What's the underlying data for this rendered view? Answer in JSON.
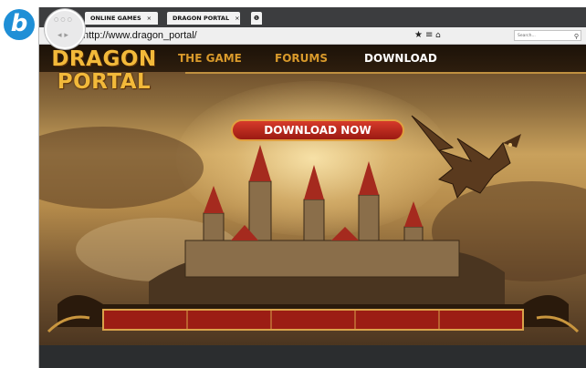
{
  "figure_label": "b",
  "browser": {
    "tabs": [
      {
        "label": "ONLINE GAMES",
        "close": "×"
      },
      {
        "label": "DRAGON PORTAL",
        "close": "×"
      }
    ],
    "new_tab_icon": "info-icon",
    "url": "http://www.dragon_portal/",
    "search_placeholder": "Search...",
    "icons": [
      "star-icon",
      "menu-icon",
      "home-icon",
      "search-icon"
    ]
  },
  "site": {
    "logo_line1": "DRAGON",
    "logo_line2": "PORTAL",
    "nav": [
      {
        "label": "THE GAME"
      },
      {
        "label": "FORUMS"
      },
      {
        "label": "DOWNLOAD"
      }
    ],
    "cta_label": "DOWNLOAD NOW"
  },
  "colors": {
    "accent_gold": "#d99a2b",
    "cta_red": "#c22a1e",
    "label_blue": "#1f8fd6"
  }
}
